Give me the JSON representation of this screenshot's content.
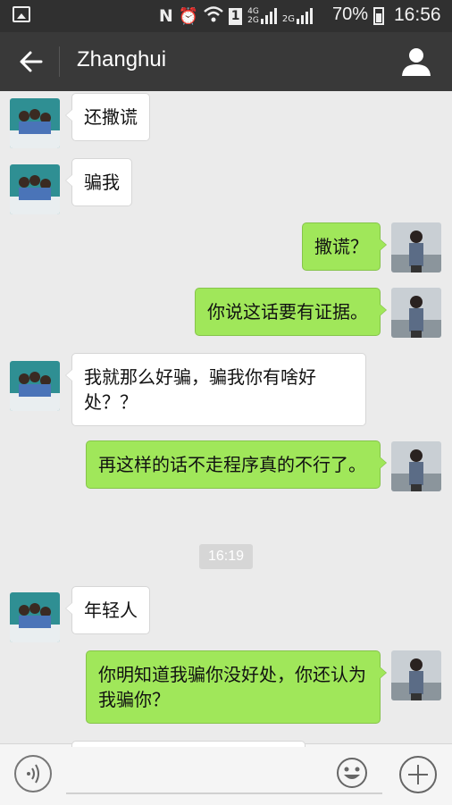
{
  "status_bar": {
    "battery_percent": "70%",
    "time": "16:56",
    "net_4g_label": "4G",
    "net_2g_label": "2G"
  },
  "header": {
    "title": "Zhanghui"
  },
  "messages": [
    {
      "side": "them",
      "text": "还撒谎"
    },
    {
      "side": "them",
      "text": "骗我"
    },
    {
      "side": "me",
      "text": "撒谎？"
    },
    {
      "side": "me",
      "text": "你说这话要有证据。"
    },
    {
      "side": "them",
      "text": "我就那么好骗，骗我你有啥好处？？"
    },
    {
      "side": "me",
      "text": "再这样的话不走程序真的不行了。"
    },
    {
      "side": "them",
      "text": "年轻人"
    },
    {
      "side": "me",
      "text": "你明知道我骗你没好处，你还认为我骗你？"
    }
  ],
  "timestamp": "16:19",
  "colors": {
    "header_bg": "#393939",
    "statusbar_bg": "#303030",
    "chat_bg": "#ebebeb",
    "my_bubble": "#a0e75a",
    "their_bubble": "#ffffff"
  },
  "icons": {
    "back": "arrow-left-icon",
    "profile": "person-icon",
    "voice": "voice-icon",
    "emoji": "emoji-icon",
    "more": "plus-icon"
  }
}
